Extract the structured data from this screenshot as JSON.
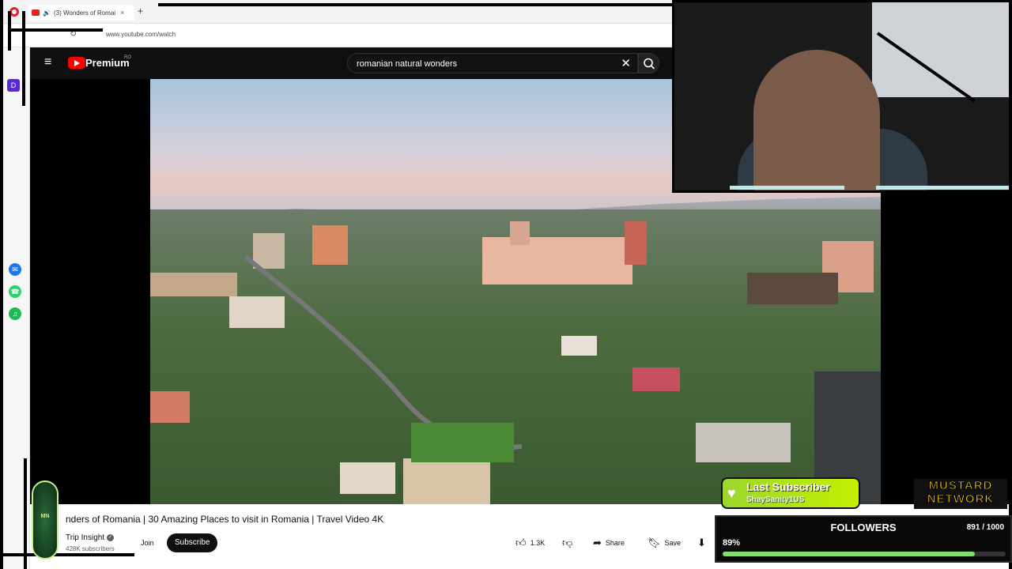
{
  "browser": {
    "tab_title": "(3) Wonders of Romai",
    "tab_close": "×",
    "new_tab": "+",
    "url": "www.youtube.com/watch"
  },
  "youtube": {
    "brand": "Premium",
    "region": "RO",
    "search_value": "romanian natural wonders",
    "search_clear": "✕"
  },
  "video": {
    "title": "nders of Romania | 30 Amazing Places to visit in Romania | Travel Video 4K",
    "channel": "Trip Insight",
    "subscribers": "428K subscribers",
    "join_label": "Join",
    "subscribe_label": "Subscribe",
    "likes": "1.3K",
    "share_label": "Share",
    "save_label": "Save"
  },
  "overlay": {
    "last_subscriber_title": "Last Subscriber",
    "last_subscriber_name": "ShaySanity1US",
    "network_line1": "MUSTARD",
    "network_line2": "NETWORK",
    "followers_label": "FOLLOWERS",
    "followers_count": "891 / 1000",
    "followers_percent": "89%",
    "followers_progress": 0.891,
    "accent_color": "#7ee06a"
  },
  "colors": {
    "youtube_red": "#ff0000",
    "masthead_bg": "#0f0f0f"
  }
}
